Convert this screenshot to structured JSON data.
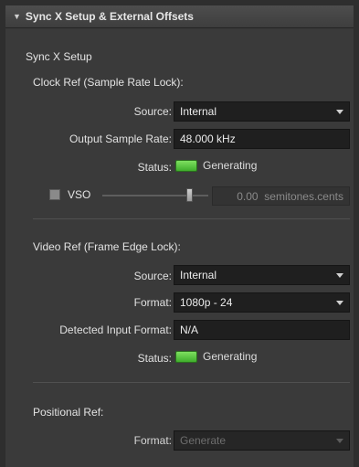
{
  "header": {
    "title": "Sync X Setup & External Offsets"
  },
  "sync_setup": {
    "title": "Sync X Setup"
  },
  "clock_ref": {
    "title": "Clock Ref (Sample Rate Lock):",
    "source_label": "Source:",
    "source_value": "Internal",
    "output_rate_label": "Output Sample Rate:",
    "output_rate_value": "48.000 kHz",
    "status_label": "Status:",
    "status_value": "Generating",
    "status_color": "#5ccf3e"
  },
  "vso": {
    "label": "VSO",
    "checked": false,
    "slider_level": 0.5,
    "value": "0.00",
    "unit": "semitones.cents"
  },
  "video_ref": {
    "title": "Video Ref (Frame Edge Lock):",
    "source_label": "Source:",
    "source_value": "Internal",
    "format_label": "Format:",
    "format_value": "1080p - 24",
    "detected_label": "Detected Input Format:",
    "detected_value": "N/A",
    "status_label": "Status:",
    "status_value": "Generating",
    "status_color": "#5ccf3e"
  },
  "positional_ref": {
    "title": "Positional Ref:",
    "format_label": "Format:",
    "format_value": "Generate"
  }
}
